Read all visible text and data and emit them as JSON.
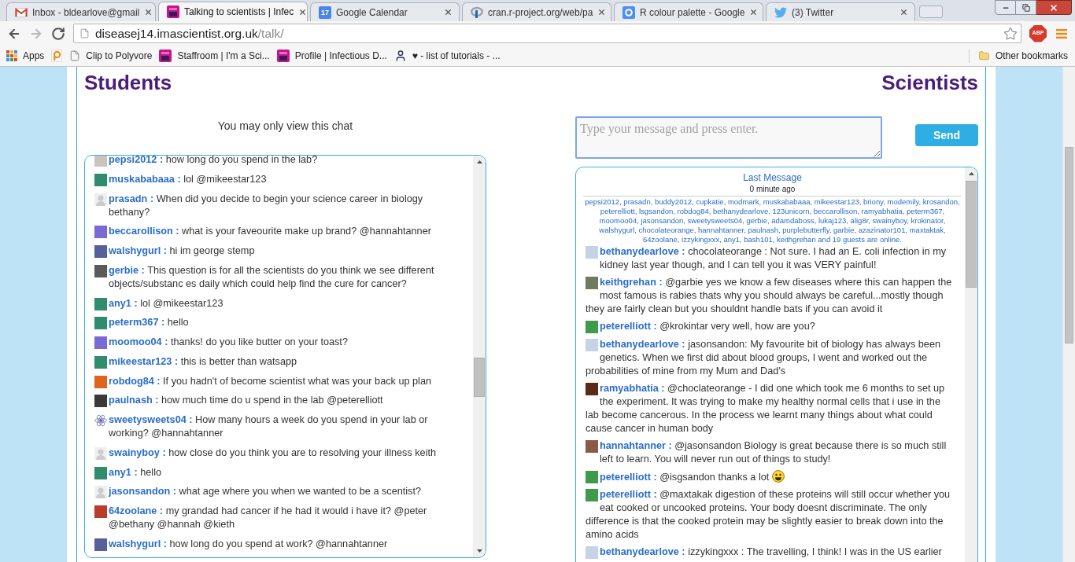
{
  "tabs": [
    {
      "title": "Inbox - bldearlove@gmail",
      "kind": "mail",
      "selected": false
    },
    {
      "title": "Talking to scientists | Infec",
      "kind": "site",
      "selected": true
    },
    {
      "title": "Google Calendar",
      "kind": "calendar",
      "icon_text": "17",
      "selected": false
    },
    {
      "title": "cran.r-project.org/web/pa",
      "kind": "project",
      "selected": false
    },
    {
      "title": "R colour palette - Google",
      "kind": "search",
      "selected": false
    },
    {
      "title": "(3) Twitter",
      "kind": "social",
      "selected": false
    }
  ],
  "toolbar": {
    "nav": [
      {
        "kind": "back",
        "disabled": false
      },
      {
        "kind": "forward",
        "disabled": true
      },
      {
        "kind": "reload",
        "disabled": false
      }
    ],
    "url_host": "diseasej14.imascientist.org.uk",
    "url_path": "/talk/",
    "extension_label": "ABP"
  },
  "bookmarks": {
    "items": [
      {
        "label": "Apps",
        "kind": "apps"
      },
      {
        "kind": "logo"
      },
      {
        "label": "Clip to Polyvore",
        "kind": "page"
      },
      {
        "label": "Staffroom | I'm a Sci...",
        "kind": "site"
      },
      {
        "label": "Profile | Infectious D...",
        "kind": "site"
      },
      {
        "label": "♥ - list of tutorials - ...",
        "kind": "person"
      }
    ],
    "other": "Other bookmarks"
  },
  "students": {
    "heading": "Students",
    "notice": "You may only view this chat",
    "messages": [
      {
        "author": "pepsi2012 :",
        "text": "how long do you spend in the lab?",
        "avatar": {
          "kind": "photo",
          "color": "#c9c5bd"
        }
      },
      {
        "author": "muskababaaa :",
        "text": "lol @mikeestar123",
        "avatar": {
          "kind": "photo",
          "color": "#2f8c6c"
        }
      },
      {
        "author": "prasadn :",
        "text": "When did you decide to begin your science career in biology bethany?",
        "avatar": {
          "kind": "default"
        }
      },
      {
        "author": "beccarollison :",
        "text": "what is your faveourite make up brand? @hannahtanner",
        "avatar": {
          "kind": "photo",
          "color": "#7b6ad6"
        }
      },
      {
        "author": "walshygurl :",
        "text": "hi im george stemp",
        "avatar": {
          "kind": "photo",
          "color": "#56609a"
        }
      },
      {
        "author": "gerbie :",
        "text": "This question is for all the scientists do you think we see different objects/substanc es daily which could help find the cure for cancer?",
        "avatar": {
          "kind": "photo",
          "color": "#5a5a5a"
        }
      },
      {
        "author": "any1 :",
        "text": "lol @mikeestar123",
        "avatar": {
          "kind": "photo",
          "color": "#2f8c6c"
        }
      },
      {
        "author": "peterm367 :",
        "text": "hello",
        "avatar": {
          "kind": "photo",
          "color": "#2f8c6c"
        }
      },
      {
        "author": "moomoo04 :",
        "text": "thanks! do you like butter on your toast?",
        "avatar": {
          "kind": "photo",
          "color": "#7b6ad6"
        }
      },
      {
        "author": "mikeestar123 :",
        "text": "this is better than watsapp",
        "avatar": {
          "kind": "photo",
          "color": "#2f8c6c"
        }
      },
      {
        "author": "robdog84 :",
        "text": "If you hadn't of become scientist what was your back up plan",
        "avatar": {
          "kind": "photo",
          "color": "#e0651c"
        }
      },
      {
        "author": "paulnash :",
        "text": "how much time do u spend in the lab @peterelliott",
        "avatar": {
          "kind": "photo",
          "color": "#3a3a3a"
        }
      },
      {
        "author": "sweetysweets04 :",
        "text": "How many hours a week do you spend in your lab or working? @hannahtanner",
        "avatar": {
          "kind": "atom"
        }
      },
      {
        "author": "swainyboy :",
        "text": "how close do you think you are to resolving your illness keith",
        "avatar": {
          "kind": "default"
        }
      },
      {
        "author": "any1 :",
        "text": "hello",
        "avatar": {
          "kind": "photo",
          "color": "#2f8c6c"
        }
      },
      {
        "author": "jasonsandon :",
        "text": "what age where you when we wanted to be a scentist?",
        "avatar": {
          "kind": "default"
        }
      },
      {
        "author": "64zoolane :",
        "text": "my grandad had cancer if he had it would i have it? @peter @bethany @hannah @kieth",
        "avatar": {
          "kind": "photo",
          "color": "#b83c2c"
        }
      },
      {
        "author": "walshygurl :",
        "text": "how long do you spend at work? @hannahtanner",
        "avatar": {
          "kind": "photo",
          "color": "#56609a"
        }
      }
    ]
  },
  "scientists": {
    "heading": "Scientists",
    "composer": {
      "placeholder": "Type your message and press enter."
    },
    "send": "Send",
    "last_message": {
      "title": "Last Message",
      "time": "0 minute ago"
    },
    "online": "pepsi2012, prasadn, buddy2012, cupkatie, modmark, muskababaaa, mikeestar123, briony, modemily, krosandon, peterelliott, lsgsandon, robdog84, bethanydearlove, 123unicorn, beccarollison, ramyabhatia, peterm367, moomoo04, jasonsandon, sweetysweets04, gerbie, adamdaboss, lukaj123, alig8r, swainyboy, krokinator, walshygurl, chocolateorange, hannahtanner, paulnash, purplebutterfly, garbie, azazinator101, maxtaktak, 64zoolane, izzykingxxx, any1, bash101, keithgrehan and 19 guests are online.",
    "messages": [
      {
        "author": "bethanydearlove :",
        "text": "chocolateorange : Not sure. I had an E. coli infection in my kidney last year though, and I can tell you it was VERY painful!",
        "avatar": {
          "kind": "photo",
          "color": "#c6d3e6"
        }
      },
      {
        "author": "keithgrehan :",
        "text": "@garbie yes we know a few diseases where this can happen the most famous is rabies thats why you should always be careful...mostly though they are fairly clean but you shouldnt handle bats if you can avoid it",
        "avatar": {
          "kind": "photo",
          "color": "#6f7b5c"
        }
      },
      {
        "author": "peterelliott :",
        "text": "@krokintar very well, how are you?",
        "avatar": {
          "kind": "photo",
          "color": "#3f9a4c"
        }
      },
      {
        "author": "bethanydearlove :",
        "text": "jasonsandon: My favourite bit of biology has always been genetics. When we first did about blood groups, I went and worked out the probabilities of mine from my Mum and Dad's",
        "avatar": {
          "kind": "photo",
          "color": "#c6d3e6"
        }
      },
      {
        "author": "ramyabhatia :",
        "text": "@choclateorange - I did one which took me 6 months to set up the experiment. It was trying to make my healthy normal cells that i use in the lab become cancerous. In the process we learnt many things about what could cause cancer in human body",
        "avatar": {
          "kind": "photo",
          "color": "#5a2a1c"
        }
      },
      {
        "author": "hannahtanner :",
        "text": "@jasonsandon Biology is great because there is so much still left to learn. You will never run out of things to study!",
        "avatar": {
          "kind": "photo",
          "color": "#8a5a48"
        }
      },
      {
        "author": "peterelliott :",
        "text": "@isgsandon thanks a lot",
        "avatar": {
          "kind": "photo",
          "color": "#3f9a4c"
        },
        "emoticon": true
      },
      {
        "author": "peterelliott :",
        "text": "@maxtakak digestion of these proteins will still occur whether you eat cooked or uncooked proteins. Your body doesnt discriminate. The only difference is that the cooked protein may be slightly easier to break down into the amino acids",
        "avatar": {
          "kind": "photo",
          "color": "#3f9a4c"
        }
      },
      {
        "author": "bethanydearlove :",
        "text": "izzykingxxx : The travelling, I think! I was in the US earlier",
        "avatar": {
          "kind": "photo",
          "color": "#c6d3e6"
        }
      }
    ]
  }
}
